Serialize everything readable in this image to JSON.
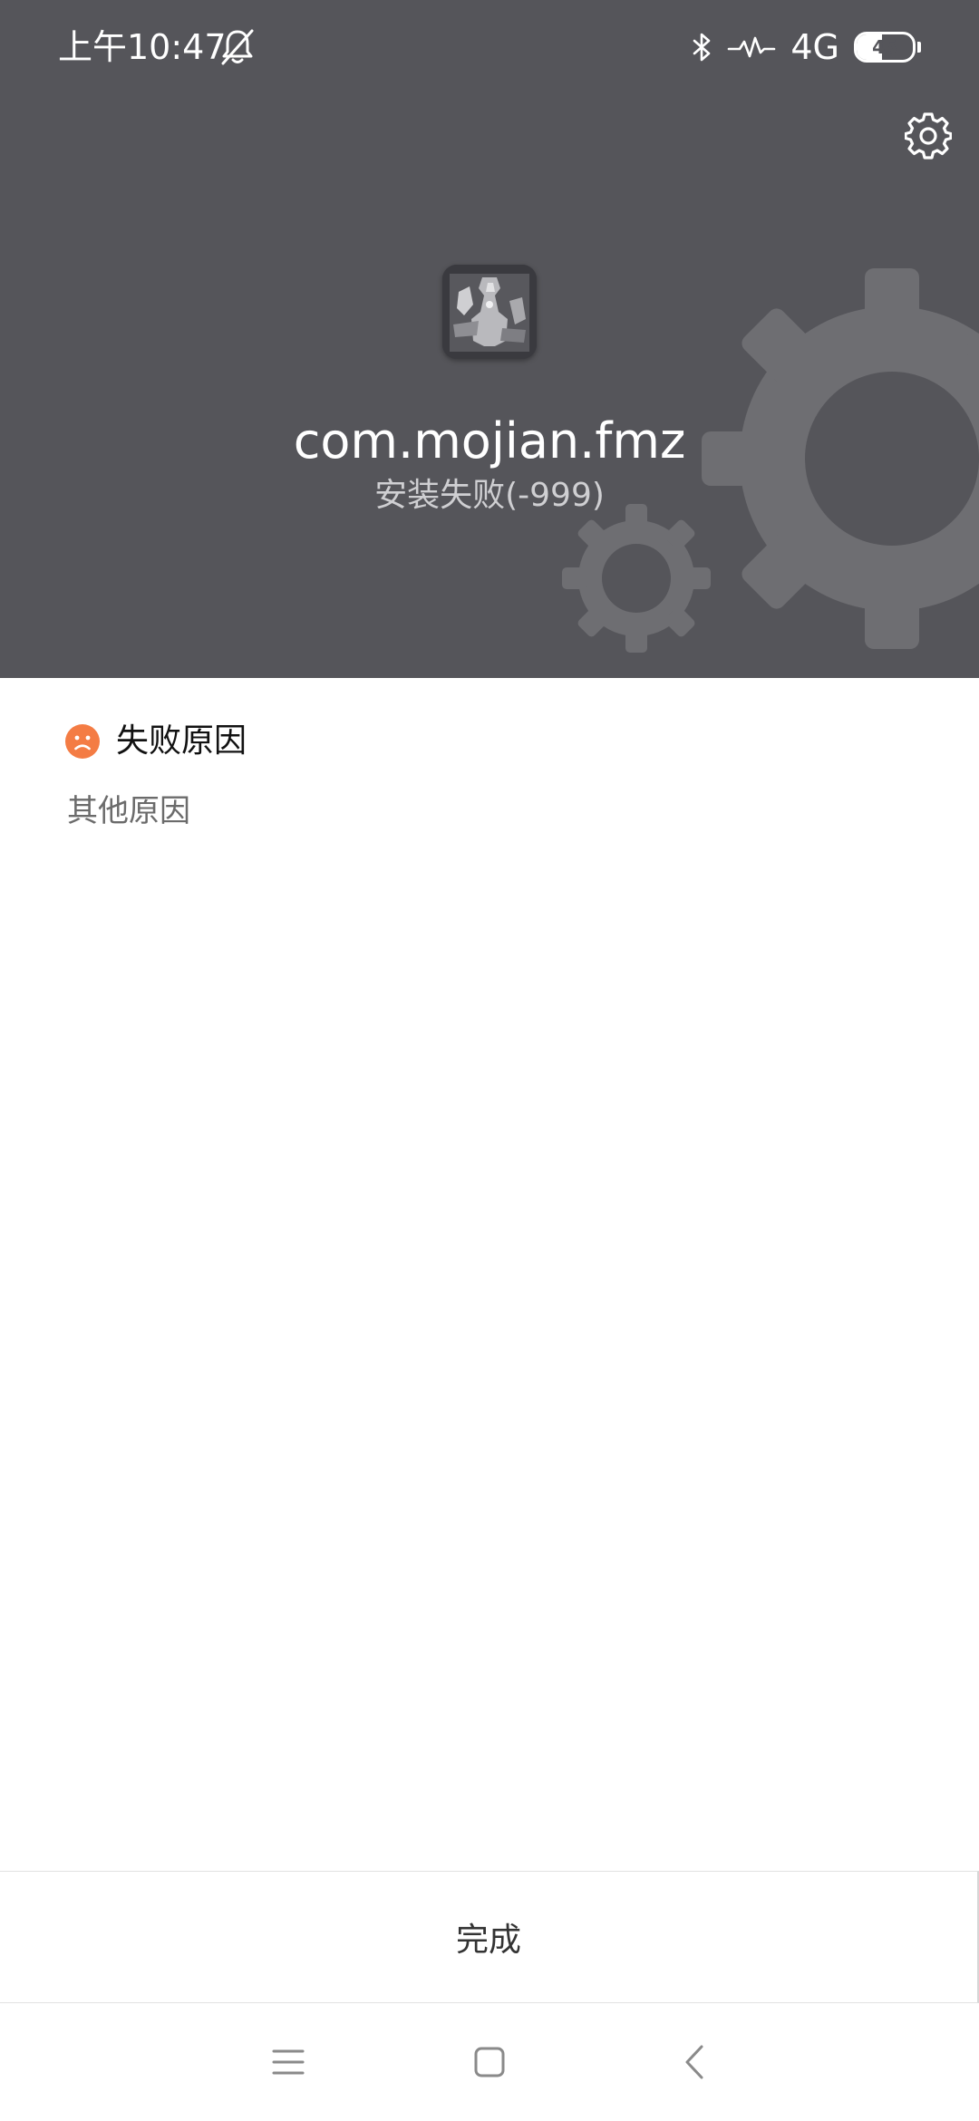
{
  "status_bar": {
    "time": "上午10:47",
    "network": "4G",
    "battery": {
      "label": "45",
      "level": 0.45
    },
    "icons": [
      "bell-off-icon",
      "bluetooth-icon",
      "signal-icon"
    ]
  },
  "header": {
    "background": "#55555a",
    "app_name": "com.mojian.fmz",
    "status": "安装失败(-999)",
    "settings_icon": "gear-icon"
  },
  "reason": {
    "title": "失败原因",
    "detail": "其他原因",
    "icon": "sad-face-icon",
    "icon_color": "#f47c44"
  },
  "footer": {
    "done_label": "完成"
  },
  "nav_bar": {
    "icons": [
      "menu-icon",
      "home-icon",
      "back-icon"
    ]
  }
}
